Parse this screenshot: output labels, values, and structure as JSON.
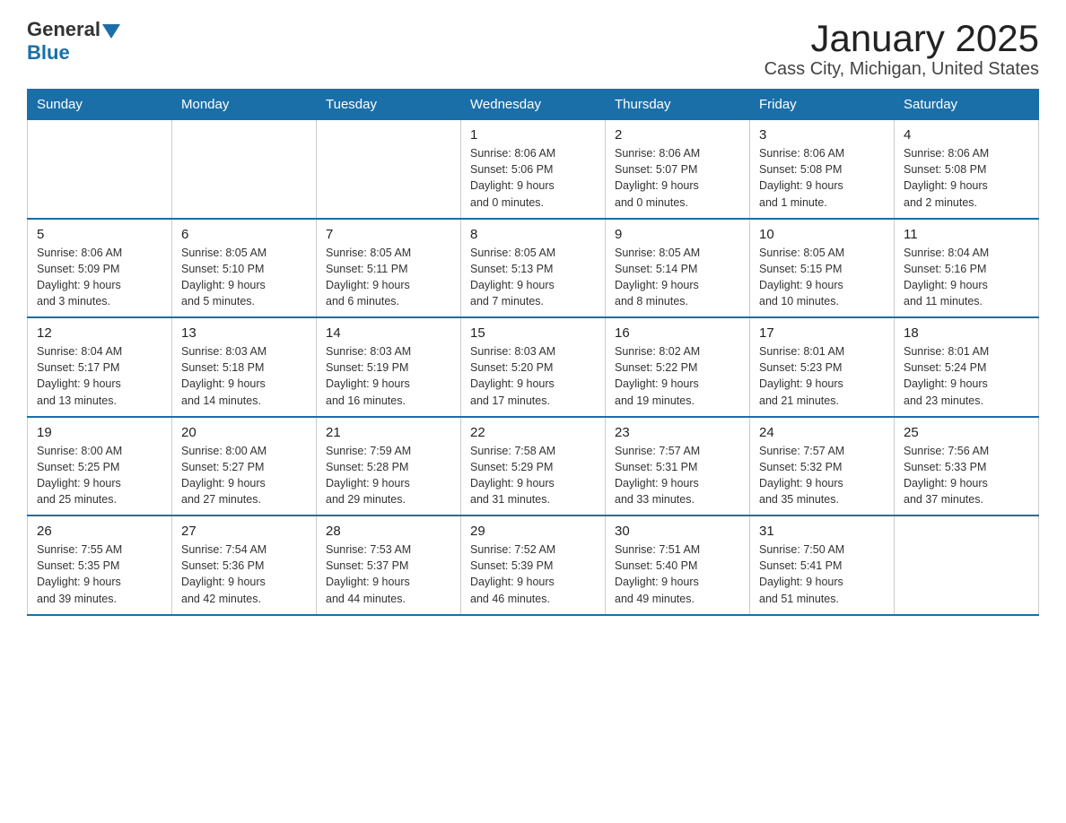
{
  "logo": {
    "general": "General",
    "blue": "Blue"
  },
  "title": "January 2025",
  "subtitle": "Cass City, Michigan, United States",
  "weekdays": [
    "Sunday",
    "Monday",
    "Tuesday",
    "Wednesday",
    "Thursday",
    "Friday",
    "Saturday"
  ],
  "weeks": [
    [
      {
        "day": "",
        "info": ""
      },
      {
        "day": "",
        "info": ""
      },
      {
        "day": "",
        "info": ""
      },
      {
        "day": "1",
        "info": "Sunrise: 8:06 AM\nSunset: 5:06 PM\nDaylight: 9 hours\nand 0 minutes."
      },
      {
        "day": "2",
        "info": "Sunrise: 8:06 AM\nSunset: 5:07 PM\nDaylight: 9 hours\nand 0 minutes."
      },
      {
        "day": "3",
        "info": "Sunrise: 8:06 AM\nSunset: 5:08 PM\nDaylight: 9 hours\nand 1 minute."
      },
      {
        "day": "4",
        "info": "Sunrise: 8:06 AM\nSunset: 5:08 PM\nDaylight: 9 hours\nand 2 minutes."
      }
    ],
    [
      {
        "day": "5",
        "info": "Sunrise: 8:06 AM\nSunset: 5:09 PM\nDaylight: 9 hours\nand 3 minutes."
      },
      {
        "day": "6",
        "info": "Sunrise: 8:05 AM\nSunset: 5:10 PM\nDaylight: 9 hours\nand 5 minutes."
      },
      {
        "day": "7",
        "info": "Sunrise: 8:05 AM\nSunset: 5:11 PM\nDaylight: 9 hours\nand 6 minutes."
      },
      {
        "day": "8",
        "info": "Sunrise: 8:05 AM\nSunset: 5:13 PM\nDaylight: 9 hours\nand 7 minutes."
      },
      {
        "day": "9",
        "info": "Sunrise: 8:05 AM\nSunset: 5:14 PM\nDaylight: 9 hours\nand 8 minutes."
      },
      {
        "day": "10",
        "info": "Sunrise: 8:05 AM\nSunset: 5:15 PM\nDaylight: 9 hours\nand 10 minutes."
      },
      {
        "day": "11",
        "info": "Sunrise: 8:04 AM\nSunset: 5:16 PM\nDaylight: 9 hours\nand 11 minutes."
      }
    ],
    [
      {
        "day": "12",
        "info": "Sunrise: 8:04 AM\nSunset: 5:17 PM\nDaylight: 9 hours\nand 13 minutes."
      },
      {
        "day": "13",
        "info": "Sunrise: 8:03 AM\nSunset: 5:18 PM\nDaylight: 9 hours\nand 14 minutes."
      },
      {
        "day": "14",
        "info": "Sunrise: 8:03 AM\nSunset: 5:19 PM\nDaylight: 9 hours\nand 16 minutes."
      },
      {
        "day": "15",
        "info": "Sunrise: 8:03 AM\nSunset: 5:20 PM\nDaylight: 9 hours\nand 17 minutes."
      },
      {
        "day": "16",
        "info": "Sunrise: 8:02 AM\nSunset: 5:22 PM\nDaylight: 9 hours\nand 19 minutes."
      },
      {
        "day": "17",
        "info": "Sunrise: 8:01 AM\nSunset: 5:23 PM\nDaylight: 9 hours\nand 21 minutes."
      },
      {
        "day": "18",
        "info": "Sunrise: 8:01 AM\nSunset: 5:24 PM\nDaylight: 9 hours\nand 23 minutes."
      }
    ],
    [
      {
        "day": "19",
        "info": "Sunrise: 8:00 AM\nSunset: 5:25 PM\nDaylight: 9 hours\nand 25 minutes."
      },
      {
        "day": "20",
        "info": "Sunrise: 8:00 AM\nSunset: 5:27 PM\nDaylight: 9 hours\nand 27 minutes."
      },
      {
        "day": "21",
        "info": "Sunrise: 7:59 AM\nSunset: 5:28 PM\nDaylight: 9 hours\nand 29 minutes."
      },
      {
        "day": "22",
        "info": "Sunrise: 7:58 AM\nSunset: 5:29 PM\nDaylight: 9 hours\nand 31 minutes."
      },
      {
        "day": "23",
        "info": "Sunrise: 7:57 AM\nSunset: 5:31 PM\nDaylight: 9 hours\nand 33 minutes."
      },
      {
        "day": "24",
        "info": "Sunrise: 7:57 AM\nSunset: 5:32 PM\nDaylight: 9 hours\nand 35 minutes."
      },
      {
        "day": "25",
        "info": "Sunrise: 7:56 AM\nSunset: 5:33 PM\nDaylight: 9 hours\nand 37 minutes."
      }
    ],
    [
      {
        "day": "26",
        "info": "Sunrise: 7:55 AM\nSunset: 5:35 PM\nDaylight: 9 hours\nand 39 minutes."
      },
      {
        "day": "27",
        "info": "Sunrise: 7:54 AM\nSunset: 5:36 PM\nDaylight: 9 hours\nand 42 minutes."
      },
      {
        "day": "28",
        "info": "Sunrise: 7:53 AM\nSunset: 5:37 PM\nDaylight: 9 hours\nand 44 minutes."
      },
      {
        "day": "29",
        "info": "Sunrise: 7:52 AM\nSunset: 5:39 PM\nDaylight: 9 hours\nand 46 minutes."
      },
      {
        "day": "30",
        "info": "Sunrise: 7:51 AM\nSunset: 5:40 PM\nDaylight: 9 hours\nand 49 minutes."
      },
      {
        "day": "31",
        "info": "Sunrise: 7:50 AM\nSunset: 5:41 PM\nDaylight: 9 hours\nand 51 minutes."
      },
      {
        "day": "",
        "info": ""
      }
    ]
  ]
}
